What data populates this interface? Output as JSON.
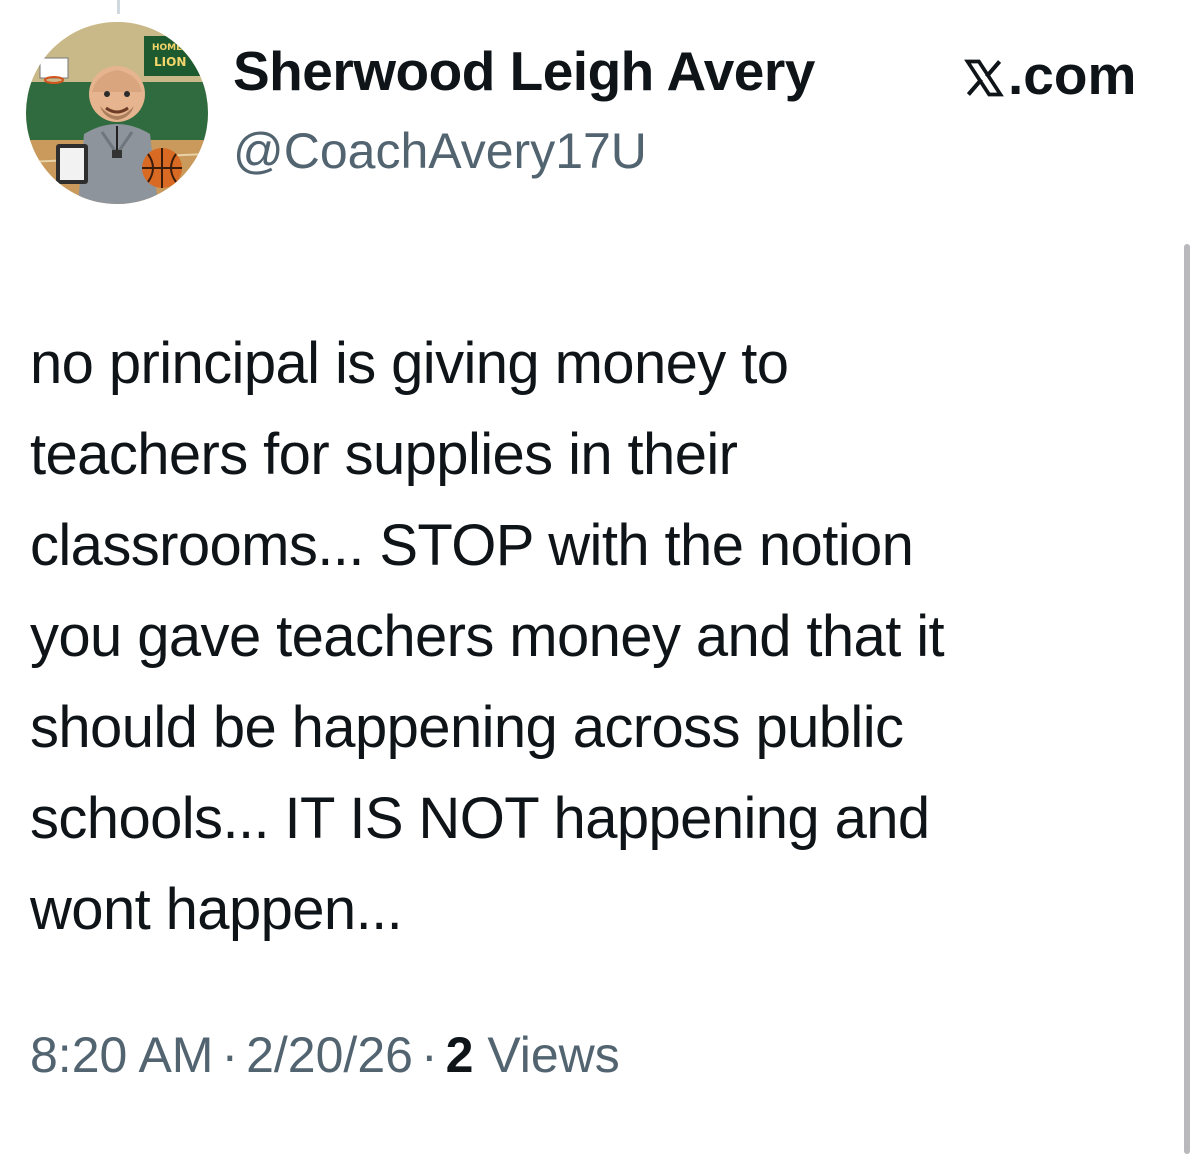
{
  "tweet": {
    "author": {
      "display_name": "Sherwood Leigh Avery",
      "handle": "@CoachAvery17U",
      "avatar_sign_text": "HOME LION"
    },
    "site_label": ".com",
    "text": "no principal is giving money to\nteachers for supplies in their\nclassrooms... STOP with the notion\nyou gave teachers money and that it\nshould be happening across public\nschools... IT IS NOT happening and\nwont happen...",
    "time": "8:20 AM",
    "date": "2/20/26",
    "separator": "·",
    "view_count": "2",
    "views_label": "Views"
  },
  "colors": {
    "text_primary": "#0f1419",
    "text_secondary": "#536471"
  },
  "icons": [
    "x-logo-icon",
    "avatar-illustration"
  ]
}
